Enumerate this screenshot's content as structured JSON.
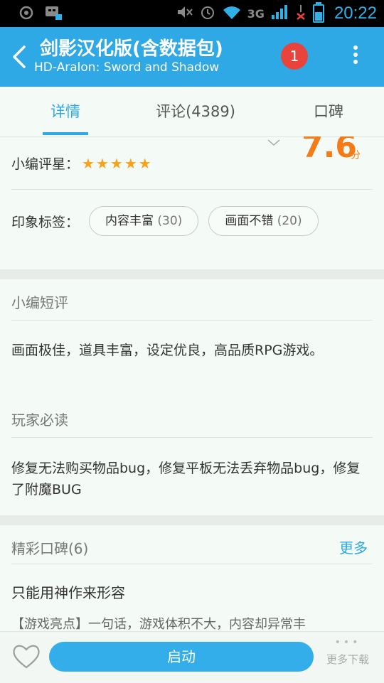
{
  "status_bar": {
    "time": "20:22",
    "network": "3G",
    "sim1": "1",
    "sim2": "2"
  },
  "title_bar": {
    "title": "剑影汉化版(含数据包)",
    "subtitle": "HD-Aralon: Sword and Shadow",
    "notification_count": "1"
  },
  "tabs": [
    {
      "label": "详情",
      "active": true
    },
    {
      "label": "评论(4389)",
      "active": false
    },
    {
      "label": "口碑",
      "active": false
    }
  ],
  "rating": {
    "score": "7.6",
    "score_unit": "分",
    "editor_rating_label": "小编评星：",
    "editor_stars": 5
  },
  "tags": {
    "label": "印象标签：",
    "items": [
      {
        "name": "内容丰富",
        "count": "(30)"
      },
      {
        "name": "画面不错",
        "count": "(20)"
      }
    ]
  },
  "editor_review": {
    "title": "小编短评",
    "text": "画面极佳，道具丰富，设定优良，高品质RPG游戏。"
  },
  "must_read": {
    "title": "玩家必读",
    "text": "修复无法购买物品bug，修复平板无法丢弃物品bug，修复了附魔BUG"
  },
  "highlights": {
    "title": "精彩口碑(6)",
    "more_label": "更多",
    "first_review_title": "只能用神作来形容",
    "first_review_excerpt": "【游戏亮点】一句话，游戏体积不大，内容却异常丰"
  },
  "bottom_bar": {
    "launch_label": "启动",
    "more_downloads_label": "更多下载"
  },
  "colors": {
    "accent": "#2fa8e6",
    "score": "#f47b16",
    "star": "#f7a21b",
    "badge": "#e8443c"
  }
}
